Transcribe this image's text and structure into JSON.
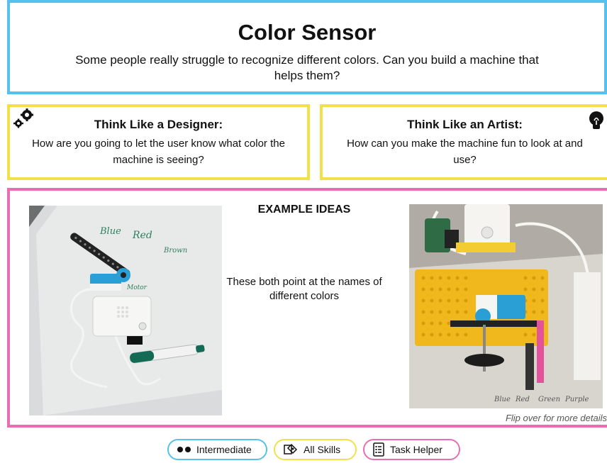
{
  "header": {
    "title": "Color Sensor",
    "intro": "Some people really struggle to recognize different colors. Can you build a machine that helps them?"
  },
  "designer_card": {
    "title": "Think Like a Designer:",
    "text": "How are you going to let the user know what color the machine is seeing?",
    "icon": "gears-icon"
  },
  "artist_card": {
    "title": "Think Like an Artist:",
    "text": "How can you make the machine fun to look at and use?",
    "icon": "lightbulb-icon"
  },
  "ideas": {
    "title": "EXAMPLE IDEAS",
    "text": "These both point at the names of different colors",
    "flip_note": "Flip over for more details",
    "left_photo_labels": [
      "Blue",
      "Red",
      "Brown",
      "Motor"
    ],
    "right_photo_labels": [
      "Blue",
      "Red",
      "Green",
      "Purple"
    ]
  },
  "footer": {
    "level": "Intermediate",
    "skills": "All Skills",
    "helper": "Task Helper"
  },
  "colors": {
    "blue": "#55c1ec",
    "yellow": "#f2e04a",
    "pink": "#e76fb1"
  }
}
